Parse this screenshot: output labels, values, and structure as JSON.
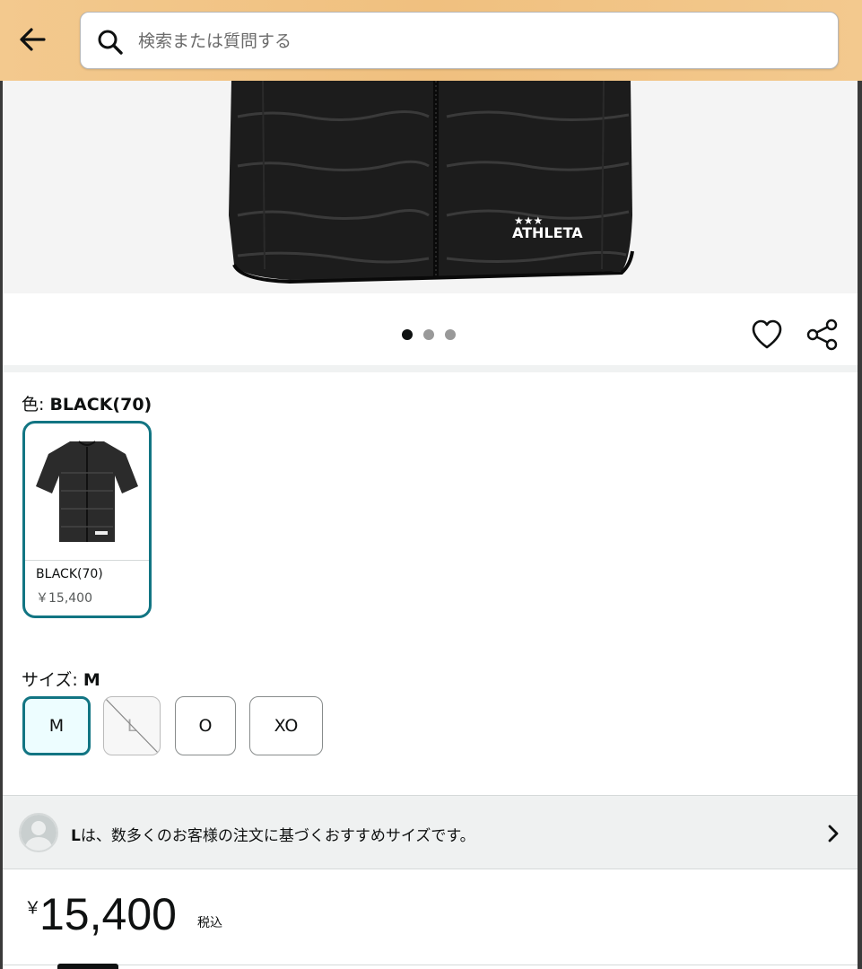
{
  "header": {
    "search_placeholder": "検索または質問する"
  },
  "product_image": {
    "brand_logo": "ATHLETA",
    "carousel_dots": 3,
    "active_dot": 1
  },
  "color": {
    "label": "色: ",
    "selected": "BLACK(70)",
    "swatches": [
      {
        "name": "BLACK(70)",
        "price": "￥15,400"
      }
    ]
  },
  "size": {
    "label": "サイズ: ",
    "selected": "M",
    "options": [
      {
        "label": "M",
        "state": "selected"
      },
      {
        "label": "L",
        "state": "unavailable"
      },
      {
        "label": "O",
        "state": "available"
      },
      {
        "label": "XO",
        "state": "available"
      }
    ]
  },
  "recommendation": {
    "size": "L",
    "text": "は、数多くのお客様の注文に基づくおすすめサイズです。"
  },
  "price": {
    "symbol": "￥",
    "amount": "15,400",
    "tax_label": "税込"
  },
  "colors": {
    "header_bg": "#f0c07f",
    "accent": "#127583"
  }
}
